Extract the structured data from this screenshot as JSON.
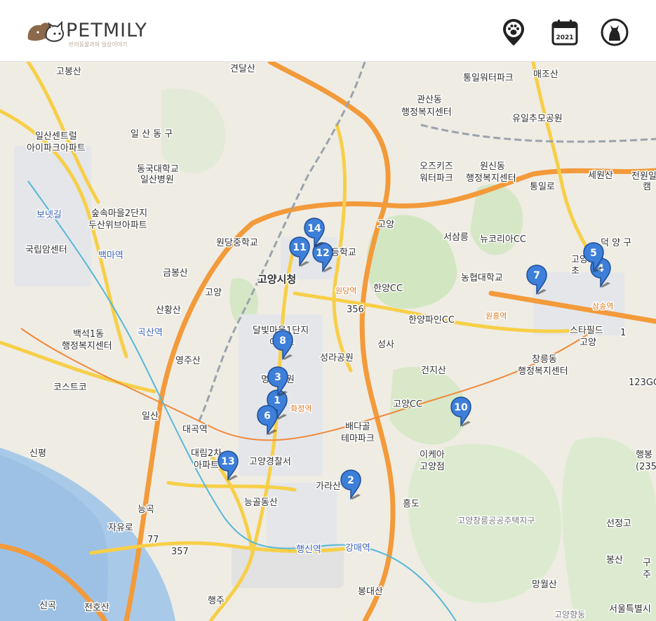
{
  "header": {
    "brand": "PETMILY",
    "tagline": "반려동물과의 일상이야기",
    "icons": [
      "location-pin-paw-icon",
      "calendar-2021-icon",
      "profile-cat-icon"
    ],
    "calendar_year": "2021"
  },
  "map": {
    "labels": [
      {
        "text": "고봉산"
      },
      {
        "text": "견달산"
      },
      {
        "text": "통일워터파크"
      },
      {
        "text": "매조산"
      },
      {
        "text": "관산동"
      },
      {
        "text": "행정복지센터"
      },
      {
        "text": "유일추모공원"
      },
      {
        "text": "일산센트럴"
      },
      {
        "text": "아이파크아파트"
      },
      {
        "text": "일 산 동 구"
      },
      {
        "text": "동국대학교"
      },
      {
        "text": "일산병원"
      },
      {
        "text": "오즈키즈"
      },
      {
        "text": "워터파크"
      },
      {
        "text": "원신동"
      },
      {
        "text": "행정복지센터"
      },
      {
        "text": "통일로"
      },
      {
        "text": "세원산"
      },
      {
        "text": "보넷길"
      },
      {
        "text": "숲속마을2단지"
      },
      {
        "text": "두산위브아파트"
      },
      {
        "text": "국립암센터"
      },
      {
        "text": "원당중학교"
      },
      {
        "text": "고등학교"
      },
      {
        "text": "고양"
      },
      {
        "text": "서삼릉"
      },
      {
        "text": "뉴코리아CC"
      },
      {
        "text": "덕 양 구"
      },
      {
        "text": "금봉산"
      },
      {
        "text": "고양시청"
      },
      {
        "text": "한양CC"
      },
      {
        "text": "농협대학교"
      },
      {
        "text": "산황산"
      },
      {
        "text": "고양"
      },
      {
        "text": "원당역"
      },
      {
        "text": "356"
      },
      {
        "text": "한양파인CC"
      },
      {
        "text": "원흥역"
      },
      {
        "text": "스타필드"
      },
      {
        "text": "고양"
      },
      {
        "text": "백석1동"
      },
      {
        "text": "행정복지센터"
      },
      {
        "text": "달빛마을1단지"
      },
      {
        "text": "아파트"
      },
      {
        "text": "성라공원"
      },
      {
        "text": "성사"
      },
      {
        "text": "창릉동"
      },
      {
        "text": "행정복지센터"
      },
      {
        "text": "영주산"
      },
      {
        "text": "건지산"
      },
      {
        "text": "명지병원"
      },
      {
        "text": "코스트코"
      },
      {
        "text": "123GC"
      },
      {
        "text": "고양CC"
      },
      {
        "text": "화정역"
      },
      {
        "text": "일산"
      },
      {
        "text": "대곡역"
      },
      {
        "text": "배다골"
      },
      {
        "text": "테마파크"
      },
      {
        "text": "신평"
      },
      {
        "text": "대림2차"
      },
      {
        "text": "아파트"
      },
      {
        "text": "고양경찰서"
      },
      {
        "text": "이케아"
      },
      {
        "text": "고양점"
      },
      {
        "text": "가라산"
      },
      {
        "text": "능곡"
      },
      {
        "text": "능골동산"
      },
      {
        "text": "흥도"
      },
      {
        "text": "고양창릉공공주택지구"
      },
      {
        "text": "선정고"
      },
      {
        "text": "자유로"
      },
      {
        "text": "77"
      },
      {
        "text": "357"
      },
      {
        "text": "행신역"
      },
      {
        "text": "강매역"
      },
      {
        "text": "봉산"
      },
      {
        "text": "망월산"
      },
      {
        "text": "신곡"
      },
      {
        "text": "전호산"
      },
      {
        "text": "행주"
      },
      {
        "text": "봉대산"
      },
      {
        "text": "고양향동"
      },
      {
        "text": "서울특별시"
      },
      {
        "text": "1"
      },
      {
        "text": "행봉"
      },
      {
        "text": "(235"
      },
      {
        "text": "전원일"
      },
      {
        "text": "캠"
      },
      {
        "text": "고양요금"
      },
      {
        "text": "초"
      },
      {
        "text": "구"
      },
      {
        "text": "주"
      },
      {
        "text": "삼송역"
      },
      {
        "text": "곡산역"
      },
      {
        "text": "백마역"
      }
    ],
    "markers": [
      "1",
      "2",
      "3",
      "4",
      "5",
      "6",
      "7",
      "8",
      "10",
      "11",
      "12",
      "13",
      "14"
    ]
  }
}
